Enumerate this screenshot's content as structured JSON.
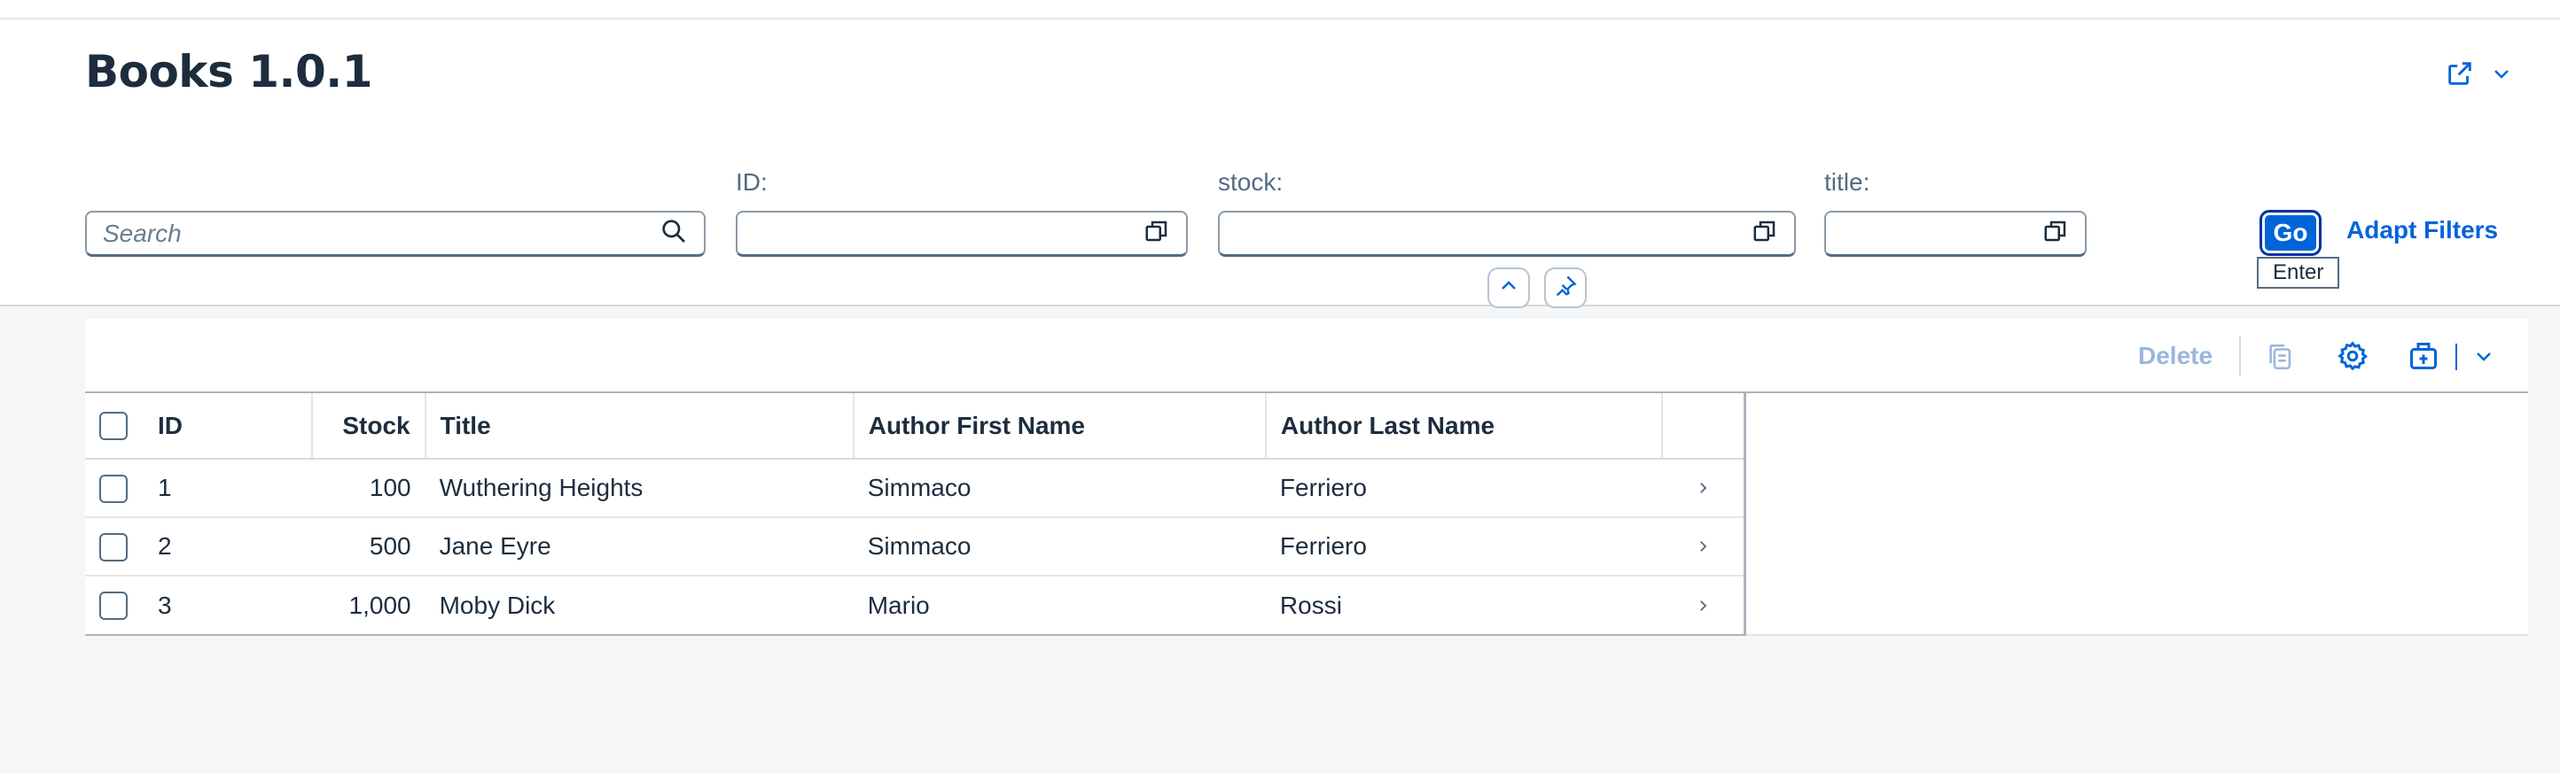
{
  "page": {
    "title": "Books 1.0.1"
  },
  "header_actions": {
    "share_icon": "share-icon",
    "expand_icon": "chevron-down-icon"
  },
  "filters": {
    "search": {
      "placeholder": "Search",
      "icon": "search-icon"
    },
    "id": {
      "label": "ID:",
      "value": ""
    },
    "stock": {
      "label": "stock:",
      "value": ""
    },
    "title": {
      "label": "title:",
      "value": ""
    },
    "go_label": "Go",
    "go_tooltip": "Enter",
    "adapt_label": "Adapt Filters"
  },
  "toolbar": {
    "delete_label": "Delete",
    "icons": [
      "copy-icon",
      "settings-icon",
      "export-icon",
      "chevron-down-icon"
    ]
  },
  "table": {
    "columns": [
      "ID",
      "Stock",
      "Title",
      "Author First Name",
      "Author Last Name"
    ],
    "rows": [
      {
        "id": "1",
        "stock": "100",
        "title": "Wuthering Heights",
        "first": "Simmaco",
        "last": "Ferriero"
      },
      {
        "id": "2",
        "stock": "500",
        "title": "Jane Eyre",
        "first": "Simmaco",
        "last": "Ferriero"
      },
      {
        "id": "3",
        "stock": "1,000",
        "title": "Moby Dick",
        "first": "Mario",
        "last": "Rossi"
      }
    ]
  },
  "colors": {
    "accent": "#0064d9",
    "text": "#1d2d3e",
    "background": "#f5f6f7"
  }
}
